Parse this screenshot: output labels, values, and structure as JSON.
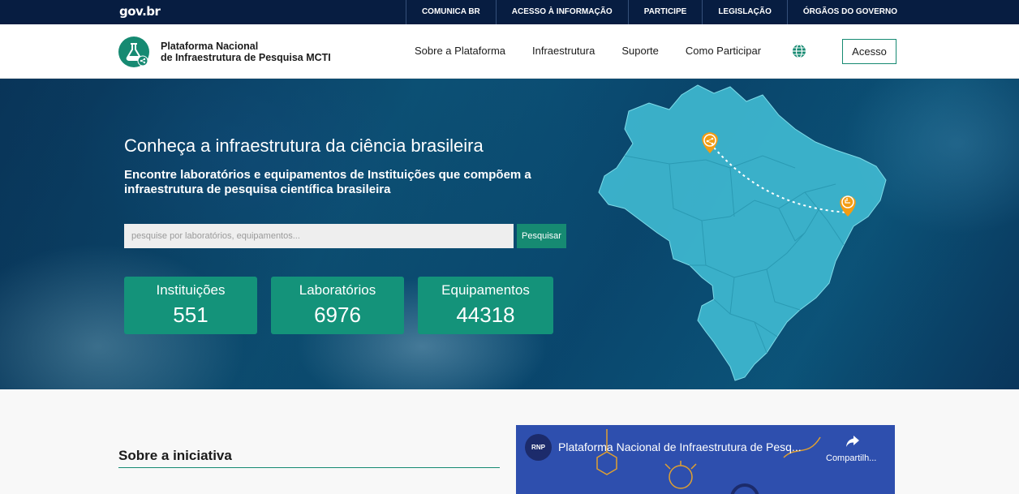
{
  "govbar": {
    "logo": "gov.br",
    "links": [
      "COMUNICA BR",
      "ACESSO À INFORMAÇÃO",
      "PARTICIPE",
      "LEGISLAÇÃO",
      "ÓRGÃOS DO GOVERNO"
    ]
  },
  "header": {
    "brand_line1": "Plataforma Nacional",
    "brand_line2": "de Infraestrutura de Pesquisa MCTI",
    "nav": [
      "Sobre a Plataforma",
      "Infraestrutura",
      "Suporte",
      "Como Participar"
    ],
    "globe_icon": "globe-icon",
    "acesso_label": "Acesso"
  },
  "hero": {
    "title": "Conheça a infraestrutura da ciência brasileira",
    "subtitle": "Encontre laboratórios e equipamentos de Instituições que compõem a infraestrutura de pesquisa científica brasileira",
    "search_placeholder": "pesquise por laboratórios, equipamentos...",
    "search_button": "Pesquisar",
    "stats": [
      {
        "label": "Instituições",
        "value": "551"
      },
      {
        "label": "Laboratórios",
        "value": "6976"
      },
      {
        "label": "Equipamentos",
        "value": "44318"
      }
    ]
  },
  "lower": {
    "section_title": "Sobre a iniciativa",
    "video": {
      "channel": "RNP",
      "title": "Plataforma Nacional de Infraestrutura de Pesq...",
      "share_label": "Compartilh..."
    }
  },
  "colors": {
    "govbar": "#071d41",
    "brand_green": "#168a72",
    "stat_box": "#14937a",
    "map_fill": "#3fb9d0",
    "pin": "#f39c12"
  }
}
